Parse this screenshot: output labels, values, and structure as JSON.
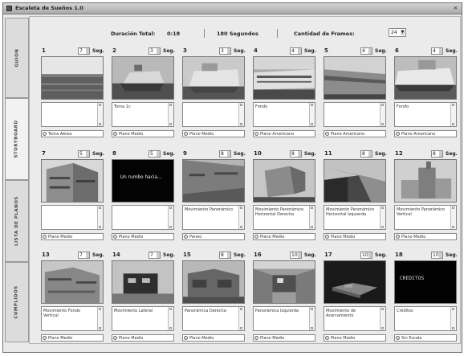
{
  "window": {
    "title": "Escaleta de Sueños 1.0",
    "close_glyph": "×"
  },
  "tabs": [
    {
      "label": "GUION"
    },
    {
      "label": "STORYBOARD"
    },
    {
      "label": "LISTA DE PLANOS"
    },
    {
      "label": "CUMPLIDOS"
    }
  ],
  "header": {
    "duration_label": "Duración Total:",
    "duration_value": "0:18",
    "seconds_text": "180 Segundos",
    "frames_label": "Cantidad de Frames:",
    "frames_value": "24"
  },
  "seg_label": "Seg.",
  "cards": [
    {
      "num": "1",
      "seg": "7",
      "desc": "",
      "select": "Toma Aérea"
    },
    {
      "num": "2",
      "seg": "3",
      "desc": "Toma 1c",
      "select": "Plano Medio"
    },
    {
      "num": "3",
      "seg": "3",
      "desc": "",
      "select": "Plano Medio"
    },
    {
      "num": "4",
      "seg": "4",
      "desc": "Fondo",
      "select": "Plano Americano"
    },
    {
      "num": "5",
      "seg": "4",
      "desc": "",
      "select": "Plano Americano"
    },
    {
      "num": "6",
      "seg": "4",
      "desc": "Fondo",
      "select": "Plano Americano"
    },
    {
      "num": "7",
      "seg": "5",
      "desc": "",
      "select": "Plano Medio"
    },
    {
      "num": "8",
      "seg": "5",
      "desc": "",
      "select": "Plano Medio"
    },
    {
      "num": "9",
      "seg": "8",
      "desc": "Movimiento Panorámico",
      "select": "Paneo"
    },
    {
      "num": "10",
      "seg": "8",
      "desc": "Movimiento Panorámico Horizontal Derecha",
      "select": "Plano Medio"
    },
    {
      "num": "11",
      "seg": "8",
      "desc": "Movimiento Panorámico Horizontal Izquierda",
      "select": "Plano Medio"
    },
    {
      "num": "12",
      "seg": "8",
      "desc": "Movimiento Panorámico Vertical",
      "select": "Plano Medio"
    },
    {
      "num": "13",
      "seg": "7",
      "desc": "Movimiento Fondo Vertical",
      "select": "Plano Medio"
    },
    {
      "num": "14",
      "seg": "7",
      "desc": "Movimiento Lateral",
      "select": "Plano Medio"
    },
    {
      "num": "15",
      "seg": "8",
      "desc": "Panorámica Derecha",
      "select": "Plano Medio"
    },
    {
      "num": "16",
      "seg": "10",
      "desc": "Panorámica Izquierda",
      "select": "Plano Medio"
    },
    {
      "num": "17",
      "seg": "10",
      "desc": "Movimiento de Acercamiento",
      "select": "Plano Medio"
    },
    {
      "num": "18",
      "seg": "10",
      "desc": "Créditos",
      "select": "Sin Escala"
    }
  ],
  "thumb_texts": {
    "card8": "Un rumbo hacia...",
    "card18": "CREDITOS"
  },
  "colors": {
    "window_bg": "#e9e9e9",
    "panel_bg": "#ebebeb",
    "titlebar": "#a9a9a9"
  }
}
